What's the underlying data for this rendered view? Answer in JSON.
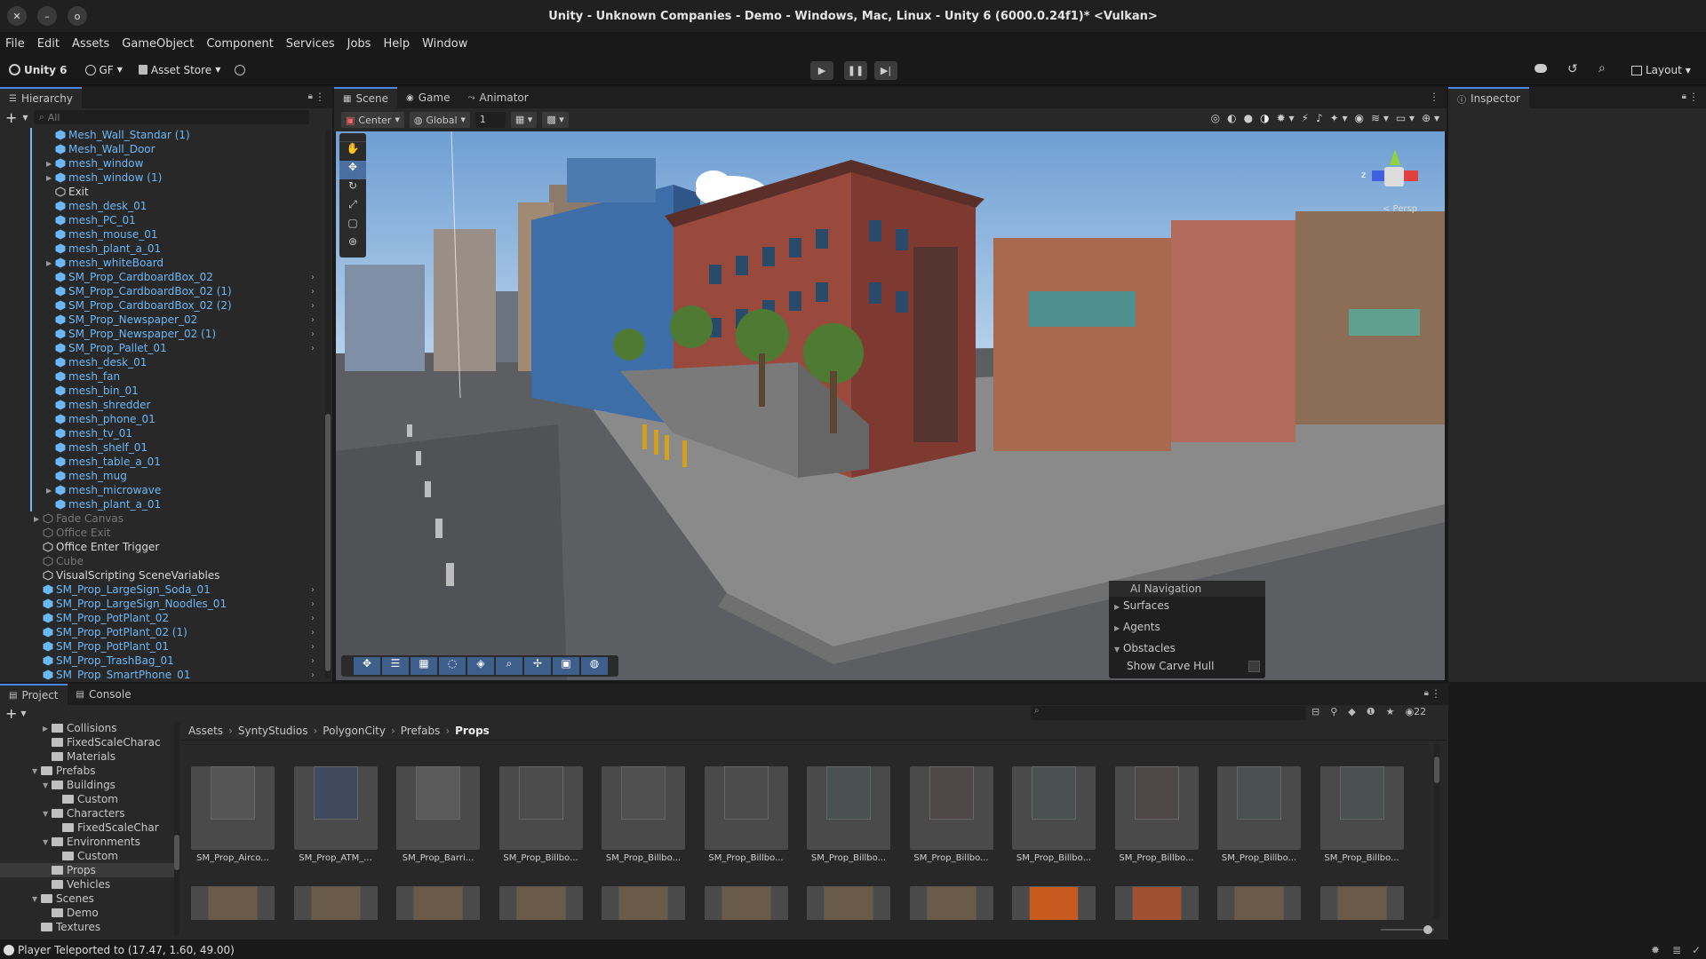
{
  "window": {
    "title": "Unity - Unknown Companies - Demo - Windows, Mac, Linux - Unity 6 (6000.0.24f1)* <Vulkan>"
  },
  "menu": [
    "File",
    "Edit",
    "Assets",
    "GameObject",
    "Component",
    "Services",
    "Jobs",
    "Help",
    "Window"
  ],
  "toolbar": {
    "unity_label": "Unity 6",
    "account": "GF",
    "asset_store": "Asset Store",
    "layout": "Layout"
  },
  "hierarchy": {
    "tab": "Hierarchy",
    "search_placeholder": "All",
    "rows": [
      {
        "name": "Mesh_Wall_Standar (1)",
        "color": "blue",
        "indent": 2,
        "arrow": ""
      },
      {
        "name": "Mesh_Wall_Door",
        "color": "blue",
        "indent": 2,
        "arrow": ""
      },
      {
        "name": "mesh_window",
        "color": "blue",
        "indent": 2,
        "arrow": "▶"
      },
      {
        "name": "mesh_window (1)",
        "color": "blue",
        "indent": 2,
        "arrow": "▶"
      },
      {
        "name": "Exit",
        "color": "white",
        "indent": 2,
        "arrow": ""
      },
      {
        "name": "mesh_desk_01",
        "color": "blue",
        "indent": 2,
        "arrow": ""
      },
      {
        "name": "mesh_PC_01",
        "color": "blue",
        "indent": 2,
        "arrow": ""
      },
      {
        "name": "mesh_mouse_01",
        "color": "blue",
        "indent": 2,
        "arrow": ""
      },
      {
        "name": "mesh_plant_a_01",
        "color": "blue",
        "indent": 2,
        "arrow": ""
      },
      {
        "name": "mesh_whiteBoard",
        "color": "blue",
        "indent": 2,
        "arrow": "▶"
      },
      {
        "name": "SM_Prop_CardboardBox_02",
        "color": "blue",
        "indent": 2,
        "arrow": "",
        "chev": true
      },
      {
        "name": "SM_Prop_CardboardBox_02 (1)",
        "color": "blue",
        "indent": 2,
        "arrow": "",
        "chev": true
      },
      {
        "name": "SM_Prop_CardboardBox_02 (2)",
        "color": "blue",
        "indent": 2,
        "arrow": "",
        "chev": true
      },
      {
        "name": "SM_Prop_Newspaper_02",
        "color": "blue",
        "indent": 2,
        "arrow": "",
        "chev": true
      },
      {
        "name": "SM_Prop_Newspaper_02 (1)",
        "color": "blue",
        "indent": 2,
        "arrow": "",
        "chev": true
      },
      {
        "name": "SM_Prop_Pallet_01",
        "color": "blue",
        "indent": 2,
        "arrow": "",
        "chev": true
      },
      {
        "name": "mesh_desk_01",
        "color": "blue",
        "indent": 2,
        "arrow": ""
      },
      {
        "name": "mesh_fan",
        "color": "blue",
        "indent": 2,
        "arrow": ""
      },
      {
        "name": "mesh_bin_01",
        "color": "blue",
        "indent": 2,
        "arrow": ""
      },
      {
        "name": "mesh_shredder",
        "color": "blue",
        "indent": 2,
        "arrow": ""
      },
      {
        "name": "mesh_phone_01",
        "color": "blue",
        "indent": 2,
        "arrow": ""
      },
      {
        "name": "mesh_tv_01",
        "color": "blue",
        "indent": 2,
        "arrow": ""
      },
      {
        "name": "mesh_shelf_01",
        "color": "blue",
        "indent": 2,
        "arrow": ""
      },
      {
        "name": "mesh_table_a_01",
        "color": "blue",
        "indent": 2,
        "arrow": ""
      },
      {
        "name": "mesh_mug",
        "color": "blue",
        "indent": 2,
        "arrow": ""
      },
      {
        "name": "mesh_microwave",
        "color": "blue",
        "indent": 2,
        "arrow": "▶"
      },
      {
        "name": "mesh_plant_a_01",
        "color": "blue",
        "indent": 2,
        "arrow": ""
      },
      {
        "name": "Fade Canvas",
        "color": "gray",
        "indent": 1,
        "arrow": "▶"
      },
      {
        "name": "Office Exit",
        "color": "gray",
        "indent": 1,
        "arrow": ""
      },
      {
        "name": "Office Enter Trigger",
        "color": "white",
        "indent": 1,
        "arrow": ""
      },
      {
        "name": "Cube",
        "color": "gray",
        "indent": 1,
        "arrow": ""
      },
      {
        "name": "VisualScripting SceneVariables",
        "color": "white",
        "indent": 1,
        "arrow": ""
      },
      {
        "name": "SM_Prop_LargeSign_Soda_01",
        "color": "blue",
        "indent": 1,
        "arrow": "",
        "chev": true
      },
      {
        "name": "SM_Prop_LargeSign_Noodles_01",
        "color": "blue",
        "indent": 1,
        "arrow": "",
        "chev": true
      },
      {
        "name": "SM_Prop_PotPlant_02",
        "color": "blue",
        "indent": 1,
        "arrow": "",
        "chev": true
      },
      {
        "name": "SM_Prop_PotPlant_02 (1)",
        "color": "blue",
        "indent": 1,
        "arrow": "",
        "chev": true
      },
      {
        "name": "SM_Prop_PotPlant_01",
        "color": "blue",
        "indent": 1,
        "arrow": "",
        "chev": true
      },
      {
        "name": "SM_Prop_TrashBag_01",
        "color": "blue",
        "indent": 1,
        "arrow": "",
        "chev": true
      },
      {
        "name": "SM_Prop_SmartPhone_01",
        "color": "blue",
        "indent": 1,
        "arrow": "",
        "chev": true
      }
    ]
  },
  "scene_tabs": [
    {
      "label": "Scene",
      "icon": "grid-icon"
    },
    {
      "label": "Game",
      "icon": "gamepad-icon"
    },
    {
      "label": "Animator",
      "icon": "animator-icon"
    }
  ],
  "scene_toolbar": {
    "pivot": "Center",
    "space": "Global",
    "grid_value": "1"
  },
  "gizmo": {
    "persp_label": "< Persp",
    "z_label": "z"
  },
  "ai_navigation": {
    "title": "AI Navigation",
    "items": [
      {
        "label": "Surfaces",
        "arrow": "▶"
      },
      {
        "label": "Agents",
        "arrow": "▶"
      },
      {
        "label": "Obstacles",
        "arrow": "▼"
      }
    ],
    "show_carve_hull": "Show Carve Hull"
  },
  "inspector": {
    "tab": "Inspector"
  },
  "project": {
    "tabs": [
      "Project",
      "Console"
    ],
    "breadcrumb": [
      "Assets",
      "SyntyStudios",
      "PolygonCity",
      "Prefabs",
      "Props"
    ],
    "count": "22",
    "tree": [
      {
        "name": "Collisions",
        "indent": 4,
        "arrow": "▶"
      },
      {
        "name": "FixedScaleCharac",
        "indent": 4,
        "arrow": ""
      },
      {
        "name": "Materials",
        "indent": 4,
        "arrow": ""
      },
      {
        "name": "Prefabs",
        "indent": 3,
        "arrow": "▼"
      },
      {
        "name": "Buildings",
        "indent": 4,
        "arrow": "▼"
      },
      {
        "name": "Custom",
        "indent": 5,
        "arrow": ""
      },
      {
        "name": "Characters",
        "indent": 4,
        "arrow": "▼"
      },
      {
        "name": "FixedScaleChar",
        "indent": 5,
        "arrow": ""
      },
      {
        "name": "Environments",
        "indent": 4,
        "arrow": "▼"
      },
      {
        "name": "Custom",
        "indent": 5,
        "arrow": ""
      },
      {
        "name": "Props",
        "indent": 4,
        "arrow": "",
        "selected": true
      },
      {
        "name": "Vehicles",
        "indent": 4,
        "arrow": ""
      },
      {
        "name": "Scenes",
        "indent": 3,
        "arrow": "▼"
      },
      {
        "name": "Demo",
        "indent": 4,
        "arrow": ""
      },
      {
        "name": "Textures",
        "indent": 3,
        "arrow": ""
      }
    ],
    "assets_row1": [
      "SM_Prop_Airco...",
      "SM_Prop_ATM_...",
      "SM_Prop_Barri...",
      "SM_Prop_Billbo...",
      "SM_Prop_Billbo...",
      "SM_Prop_Billbo...",
      "SM_Prop_Billbo...",
      "SM_Prop_Billbo...",
      "SM_Prop_Billbo...",
      "SM_Prop_Billbo...",
      "SM_Prop_Billbo...",
      "SM_Prop_Billbo..."
    ],
    "assets_row2_count": 12
  },
  "status": {
    "message": "Player Teleported to (17.47, 1.60, 49.00)"
  },
  "colors": {
    "accent": "#4a8ae6",
    "prefab_blue": "#6ab8f7"
  }
}
